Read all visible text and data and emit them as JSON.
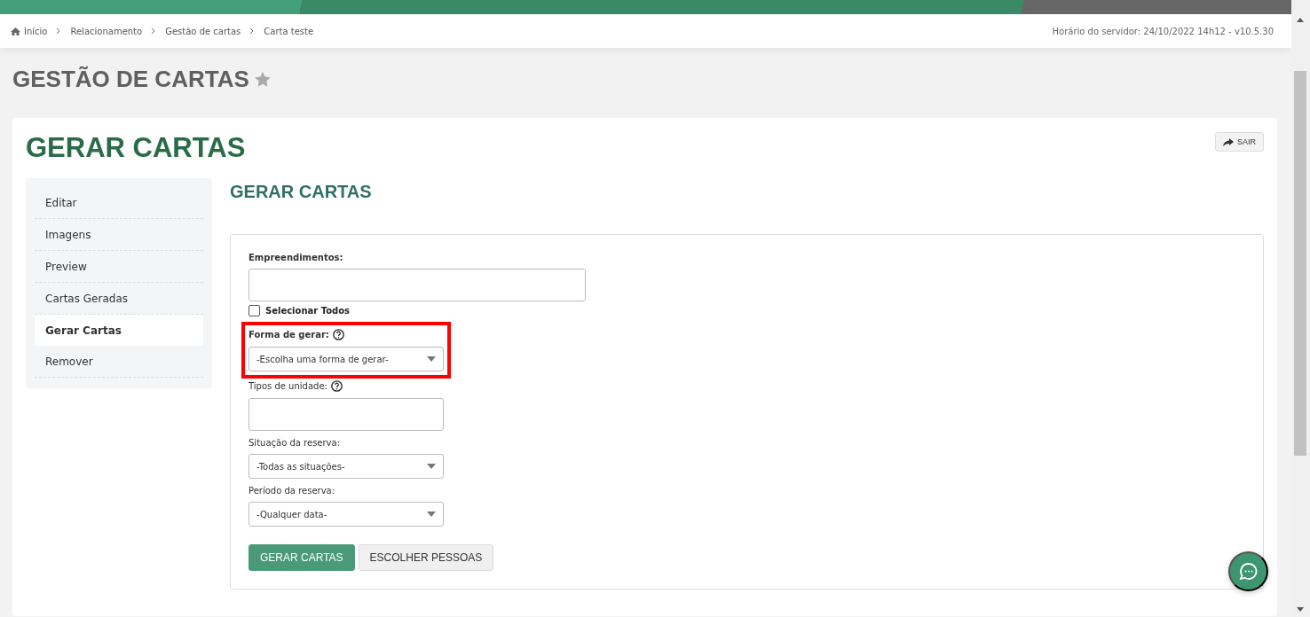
{
  "breadcrumb": [
    {
      "label": "Início",
      "home": true
    },
    {
      "label": "Relacionamento",
      "home": false
    },
    {
      "label": "Gestão de cartas",
      "home": false
    },
    {
      "label": "Carta teste",
      "home": false
    }
  ],
  "server_info": "Horário do servidor: 24/10/2022 14h12 - v10.5.30",
  "page_title": "GESTÃO DE CARTAS",
  "favorite": false,
  "card": {
    "title": "GERAR CARTAS",
    "exit_button": "SAIR"
  },
  "sidebar": {
    "items": [
      {
        "label": "Editar",
        "selected": false
      },
      {
        "label": "Imagens",
        "selected": false
      },
      {
        "label": "Preview",
        "selected": false
      },
      {
        "label": "Cartas Geradas",
        "selected": false
      },
      {
        "label": "Gerar Cartas",
        "selected": true
      },
      {
        "label": "Remover",
        "selected": false
      }
    ]
  },
  "section_title": "GERAR CARTAS",
  "form": {
    "fields": [
      {
        "kind": "input",
        "label": "Empreendimentos:",
        "bold": true,
        "help": false,
        "wide": true,
        "highlighted": false
      },
      {
        "kind": "checkbox",
        "label": "Selecionar Todos",
        "checked": false
      },
      {
        "kind": "select",
        "label": "Forma de gerar:",
        "bold": true,
        "help": true,
        "wide": false,
        "value": "-Escolha uma forma de gerar-",
        "highlighted": true
      },
      {
        "kind": "input",
        "label": "Tipos de unidade:",
        "bold": false,
        "help": true,
        "wide": false,
        "highlighted": false
      },
      {
        "kind": "select",
        "label": "Situação da reserva:",
        "bold": false,
        "help": false,
        "wide": false,
        "value": "-Todas as situações-",
        "highlighted": false
      },
      {
        "kind": "select",
        "label": "Período da reserva:",
        "bold": false,
        "help": false,
        "wide": false,
        "value": "-Qualquer data-",
        "highlighted": false
      }
    ],
    "buttons": [
      {
        "label": "GERAR CARTAS",
        "primary": true
      },
      {
        "label": "ESCOLHER PESSOAS",
        "primary": false
      }
    ]
  }
}
